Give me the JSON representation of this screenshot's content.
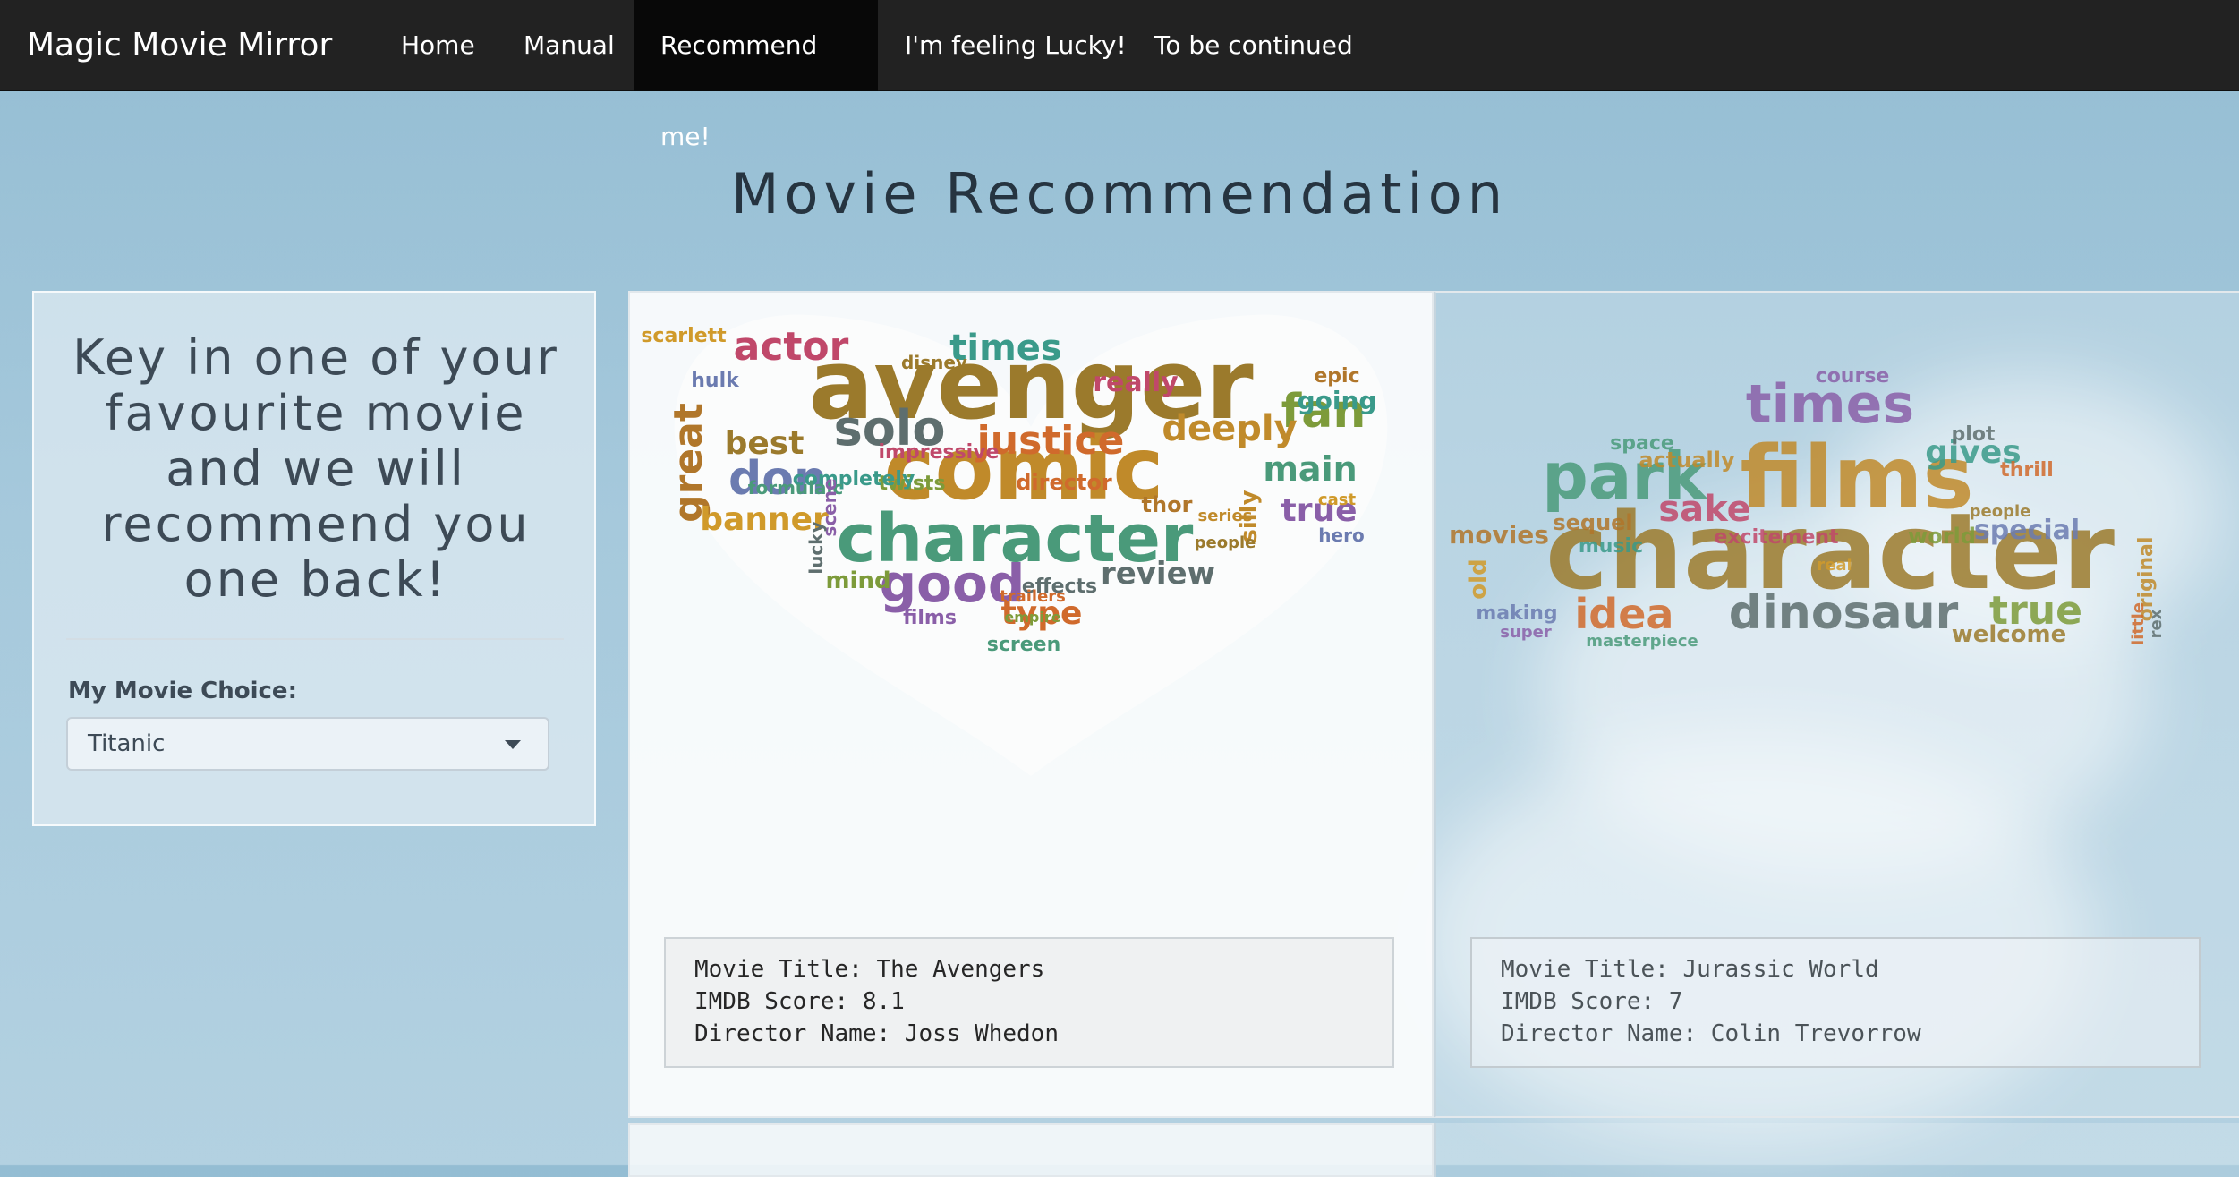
{
  "navbar": {
    "brand": "Magic Movie Mirror",
    "items": [
      {
        "label": "Home",
        "active": false
      },
      {
        "label": "Manual",
        "active": false
      },
      {
        "label": "Recommend me!",
        "active": true
      },
      {
        "label": "I'm feeling Lucky!",
        "active": false
      },
      {
        "label": "To be continued",
        "active": false
      }
    ]
  },
  "page": {
    "title": "Movie Recommendation"
  },
  "sidebar": {
    "heading_lines": [
      "Key in one of your",
      "favourite movie",
      "and we will",
      "recommend you",
      "one back!"
    ],
    "field_label": "My Movie Choice:",
    "select_value": "Titanic"
  },
  "cards": [
    {
      "wordcloud_shape": "heart",
      "words": [
        "avenger",
        "comic",
        "character",
        "good",
        "solo",
        "justice",
        "fan",
        "actor",
        "times",
        "great",
        "don",
        "banner",
        "best",
        "deeply",
        "main",
        "true",
        "review",
        "type",
        "mind",
        "really",
        "going",
        "epic",
        "hulk",
        "scarlett",
        "disney",
        "silly",
        "screen",
        "films",
        "effects",
        "director",
        "twists",
        "impressive",
        "completely",
        "thor",
        "hero",
        "cast",
        "people",
        "series",
        "formulaic",
        "scene",
        "lucky",
        "trailers",
        "empire"
      ],
      "info": {
        "title_line": "Movie Title: The Avengers",
        "score_line": "IMDB Score: 8.1",
        "director_line": "Director Name: Joss Whedon"
      }
    },
    {
      "wordcloud_shape": "cloud",
      "words": [
        "character",
        "films",
        "park",
        "times",
        "dinosaur",
        "idea",
        "true",
        "sake",
        "gives",
        "movies",
        "special",
        "old",
        "welcome",
        "actually",
        "space",
        "course",
        "plot",
        "thrill",
        "world",
        "excitement",
        "music",
        "sequel",
        "making",
        "real",
        "people",
        "original",
        "masterpiece",
        "super",
        "rex",
        "little"
      ],
      "info": {
        "title_line": "Movie Title: Jurassic World",
        "score_line": "IMDB Score: 7",
        "director_line": "Director Name: Colin Trevorrow"
      }
    }
  ],
  "colors": {
    "navbar_bg": "#222222",
    "navbar_active": "#080808",
    "heading_text": "#263440"
  }
}
